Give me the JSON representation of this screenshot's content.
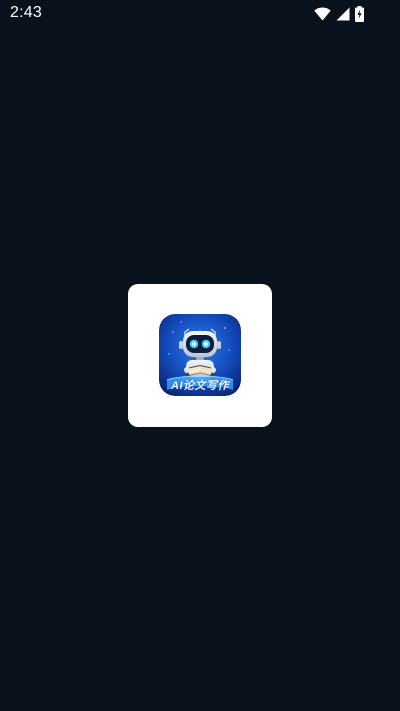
{
  "status_bar": {
    "time": "2:43",
    "icons": [
      "wifi-icon",
      "cellular-signal-icon",
      "battery-charging-icon"
    ]
  },
  "splash": {
    "app_icon_label": "AI论文写作",
    "icon_name": "robot-reading-book-logo",
    "colors": {
      "background": "#08111c",
      "card": "#ffffff",
      "icon_primary": "#1f6fe0",
      "icon_glow": "#3fd0ff"
    }
  }
}
